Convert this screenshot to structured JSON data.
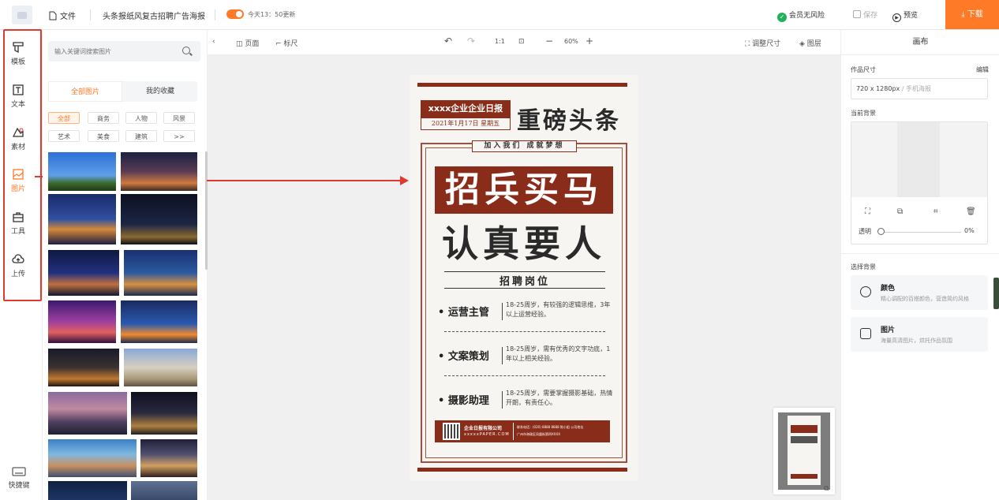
{
  "header": {
    "file_label": "文件",
    "doc_title": "头条报纸风复古招聘广告海报",
    "autosave_text": "今天13：50更新",
    "vip_label": "会员无风险",
    "save_label": "保存",
    "preview_label": "预览",
    "download_label": "下载",
    "accent_color": "#ff7a26"
  },
  "leftnav": {
    "items": [
      {
        "label": "模板",
        "icon": "template-icon"
      },
      {
        "label": "文本",
        "icon": "text-icon"
      },
      {
        "label": "素材",
        "icon": "material-icon"
      },
      {
        "label": "图片",
        "icon": "image-icon"
      },
      {
        "label": "工具",
        "icon": "toolbox-icon"
      },
      {
        "label": "上传",
        "icon": "upload-cloud-icon"
      }
    ],
    "shortcut_label": "快捷键"
  },
  "panel": {
    "search_placeholder": "输入关键词搜索图片",
    "tabs": [
      "全部图片",
      "我的收藏"
    ],
    "categories": [
      "全部",
      "商务",
      "人物",
      "风景",
      "艺术",
      "美食",
      "建筑",
      ">>"
    ]
  },
  "canvas_toolbar": {
    "page_label": "页面",
    "ruler_label": "标尺",
    "ratio_label": "1:1",
    "zoom": "60%",
    "resize_label": "调整尺寸",
    "layers_label": "图层"
  },
  "poster": {
    "brand_tag": "xxxx企业企业日报",
    "date_text": "2021年1月17日 星期五",
    "headline": "重磅头条",
    "slogan": "加入我们 成就梦想",
    "title1": "招兵买马",
    "title2": "认真要人",
    "section": "招聘岗位",
    "jobs": [
      {
        "name": "运营主管",
        "desc": "18-25周岁，有较强的逻辑思维，3年以上运营经验。"
      },
      {
        "name": "文案策划",
        "desc": "18-25周岁，需有优秀的文字功底，1年以上相关经验。"
      },
      {
        "name": "摄影助理",
        "desc": "18-25周岁，需要掌握摄影基础，热情开朗，有责任心。"
      }
    ],
    "company": "企业日报有限公司",
    "website": "xxxxxPAPER.COM",
    "phone": "联系电话：(020) 8888 8888 陈小姐 公司地址",
    "address": "广州市海珠区凤凰街第四XXXX",
    "color_dark_red": "#8a2c1a"
  },
  "rightpanel": {
    "header": "画布",
    "size_label": "作品尺寸",
    "edit_label": "编辑",
    "size_value": "720 x 1280px",
    "size_type": "/ 手机海报",
    "current_bg_label": "当前背景",
    "opacity_label": "透明",
    "opacity_value": "0%",
    "choose_bg_label": "选择背景",
    "options": [
      {
        "title": "颜色",
        "subtitle": "精心调配的百搭颜色，营造简约风格"
      },
      {
        "title": "图片",
        "subtitle": "海量高清图片，烘托作品氛围"
      }
    ]
  }
}
